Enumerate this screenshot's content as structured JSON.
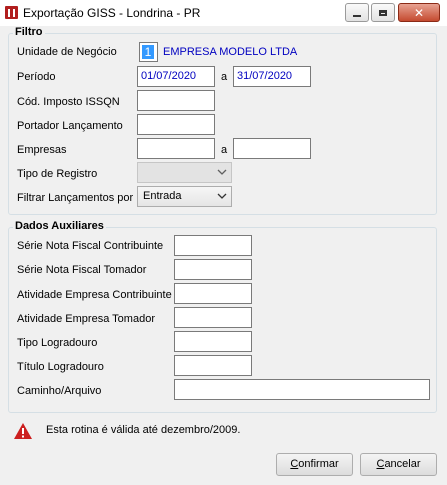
{
  "window": {
    "title": "Exportação GISS - Londrina - PR",
    "close_symbol": "✕"
  },
  "filtro": {
    "legend": "Filtro",
    "unidade_label": "Unidade de Negócio",
    "unidade_value": "1",
    "empresa_nome": "EMPRESA MODELO LTDA",
    "periodo_label": "Período",
    "periodo_inicio": "01/07/2020",
    "periodo_sep": "a",
    "periodo_fim": "31/07/2020",
    "cod_imposto_label": "Cód. Imposto ISSQN",
    "cod_imposto_value": "",
    "portador_label": "Portador Lançamento",
    "portador_value": "",
    "empresas_label": "Empresas",
    "empresas_inicio": "",
    "empresas_sep": "a",
    "empresas_fim": "",
    "tipo_registro_label": "Tipo de Registro",
    "tipo_registro_value": "",
    "filtrar_label": "Filtrar Lançamentos por",
    "filtrar_value": "Entrada"
  },
  "auxiliares": {
    "legend": "Dados Auxiliares",
    "serie_contrib_label": "Série Nota Fiscal Contribuinte",
    "serie_tomador_label": "Série Nota Fiscal Tomador",
    "ativ_contrib_label": "Atividade Empresa Contribuinte",
    "ativ_tomador_label": "Atividade Empresa Tomador",
    "tipo_logradouro_label": "Tipo Logradouro",
    "titulo_logradouro_label": "Título Logradouro",
    "caminho_label": "Caminho/Arquivo"
  },
  "warning": {
    "text": "Esta rotina é válida até dezembro/2009.",
    "icon": "warning-triangle-icon",
    "color": "#cc1f1f"
  },
  "buttons": {
    "confirmar_first": "C",
    "confirmar_rest": "onfirmar",
    "cancelar_first": "C",
    "cancelar_rest": "ancelar"
  }
}
